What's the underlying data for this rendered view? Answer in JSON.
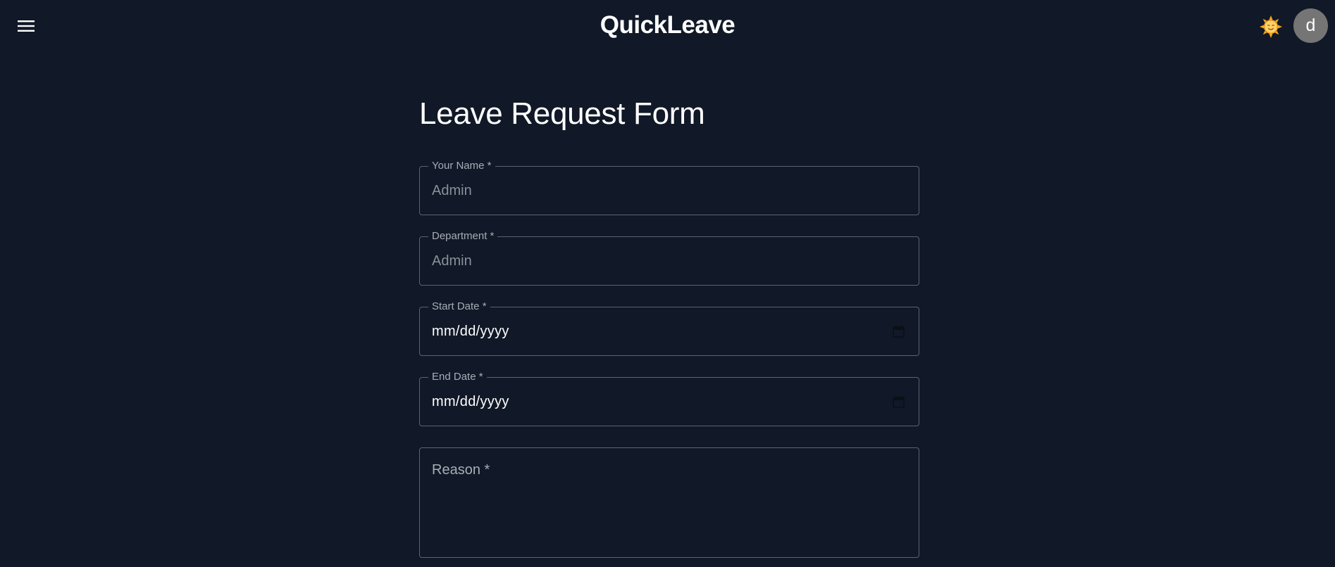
{
  "header": {
    "title": "QuickLeave",
    "menu_icon": "hamburger-menu-icon",
    "theme_icon": "sun-face-icon",
    "avatar_initial": "d"
  },
  "form": {
    "title": "Leave Request Form",
    "fields": {
      "name": {
        "label": "Your Name *",
        "value": "Admin"
      },
      "department": {
        "label": "Department *",
        "value": "Admin"
      },
      "start_date": {
        "label": "Start Date *",
        "value": "mm/dd/yyyy"
      },
      "end_date": {
        "label": "End Date *",
        "value": "mm/dd/yyyy"
      },
      "reason": {
        "label": "Reason *",
        "value": ""
      }
    }
  },
  "colors": {
    "background": "#111827",
    "border": "#5b6472",
    "label": "#a7adb6",
    "avatar": "#757575",
    "sun": "#f5a623"
  }
}
